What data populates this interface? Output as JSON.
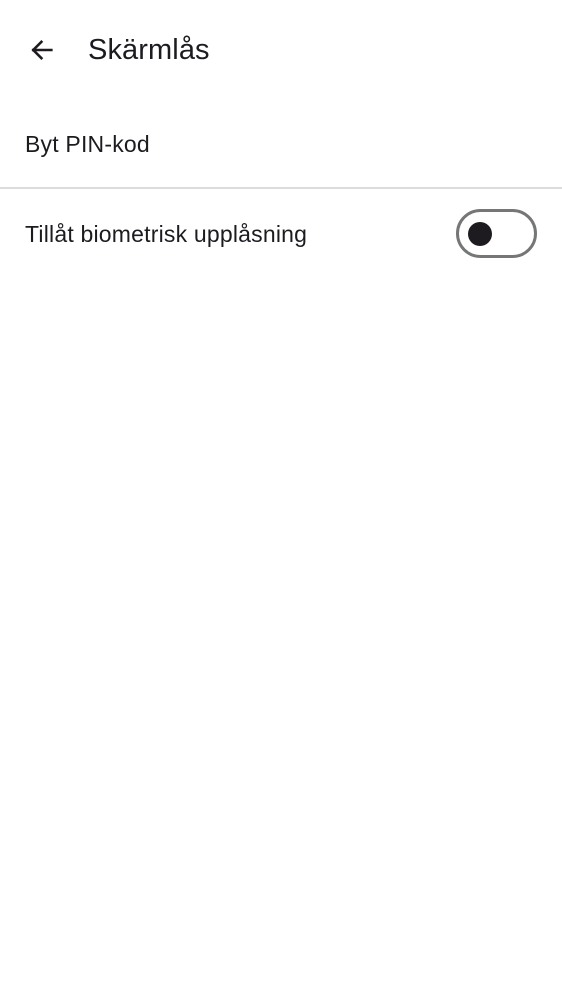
{
  "header": {
    "title": "Skärmlås",
    "back_icon": "arrow-back-icon"
  },
  "settings": {
    "change_pin": {
      "label": "Byt PIN-kod"
    },
    "biometric_unlock": {
      "label": "Tillåt biometrisk upplåsning",
      "enabled": false
    }
  },
  "colors": {
    "text": "#1d1b20",
    "divider": "#dcdcde",
    "toggle_outline": "#747775",
    "background": "#ffffff"
  }
}
